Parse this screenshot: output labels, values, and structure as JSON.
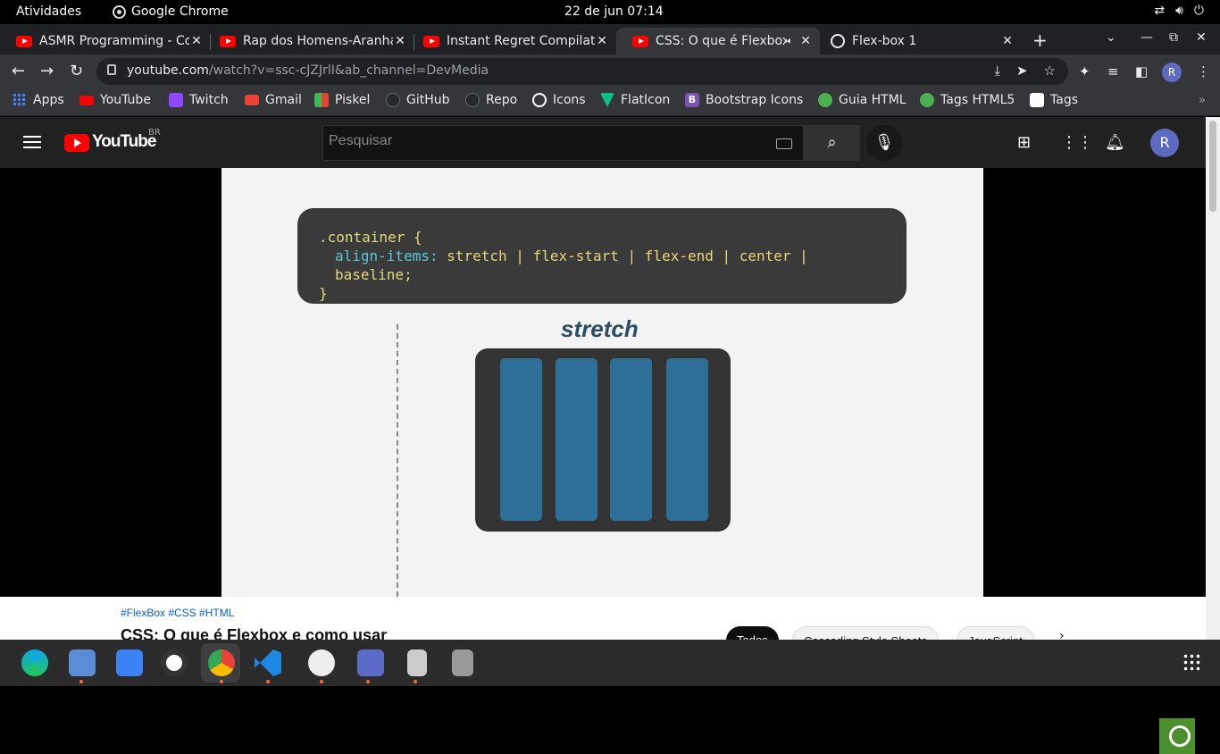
{
  "system_bar": {
    "activities": "Atividades",
    "app": "Google Chrome",
    "clock": "22 de jun  07:14"
  },
  "tabs": [
    {
      "title": "ASMR Programming - Co",
      "favicon": "youtube-icon"
    },
    {
      "title": "Rap dos Homens-Aranha",
      "favicon": "youtube-icon"
    },
    {
      "title": "Instant Regret Compilat",
      "favicon": "youtube-icon"
    },
    {
      "title": "CSS: O que é Flexbox",
      "favicon": "youtube-icon",
      "active": true,
      "audio": "speaker-icon"
    },
    {
      "title": "Flex-box 1",
      "favicon": "globe-icon"
    }
  ],
  "omnibox": {
    "url_host": "youtube.com",
    "url_rest": "/watch?v=ssc-cJZJrlI&ab_channel=DevMedia"
  },
  "profile_initial": "R",
  "bookmarks": [
    {
      "label": "Apps",
      "color": "#4285f4"
    },
    {
      "label": "YouTube",
      "color": "#ff0000"
    },
    {
      "label": "Twitch",
      "color": "#9146ff"
    },
    {
      "label": "Gmail",
      "color": "#ea4335"
    },
    {
      "label": "Piskel",
      "color": "#3cba54"
    },
    {
      "label": "GitHub",
      "color": "#24292e"
    },
    {
      "label": "Repo",
      "color": "#24292e"
    },
    {
      "label": "Icons",
      "color": "#ffffff"
    },
    {
      "label": "FlatIcon",
      "color": "#0bbf8a"
    },
    {
      "label": "Bootstrap Icons",
      "color": "#7952b3"
    },
    {
      "label": "Guia HTML",
      "color": "#4caf50"
    },
    {
      "label": "Tags HTML5",
      "color": "#4caf50"
    },
    {
      "label": "Tags",
      "color": "#ffffff"
    }
  ],
  "youtube": {
    "region": "BR",
    "wordmark": "YouTube",
    "search_placeholder": "Pesquisar",
    "avatar": "R"
  },
  "video": {
    "code_line1": ".container {",
    "code_prop": "align-items:",
    "code_values": "stretch | flex-start | flex-end | center | baseline;",
    "code_close": "}",
    "demo_label": "stretch"
  },
  "below_video": {
    "hashtags": "#FlexBox #CSS #HTML",
    "title": "CSS: O que é Flexbox e como usar",
    "chips": [
      "Todos",
      "Cascading Style Sheets",
      "JavaScript"
    ]
  },
  "taskbar_apps": [
    "edge-icon",
    "files-icon",
    "store-icon",
    "github-icon",
    "chrome-icon",
    "vscode-icon",
    "clock-icon",
    "text-editor-icon",
    "usb-icon",
    "trash-icon"
  ]
}
